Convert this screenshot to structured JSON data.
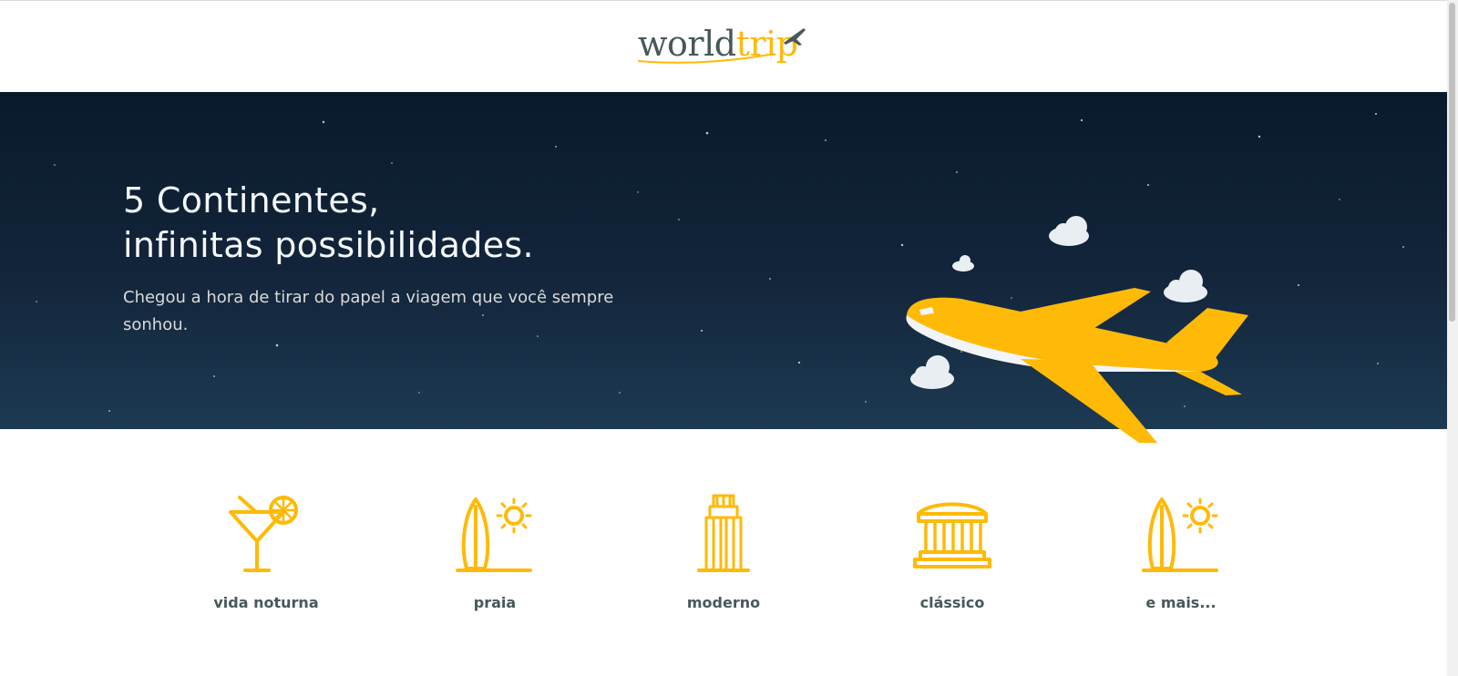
{
  "header": {
    "logo": {
      "part1": "world",
      "part2": "trip",
      "icon": "airplane-icon"
    }
  },
  "hero": {
    "title_line1": "5 Continentes,",
    "title_line2": "infinitas possibilidades.",
    "subtitle": "Chegou a hora de tirar do papel a viagem que você sempre sonhou.",
    "illustration": "airplane-with-clouds"
  },
  "travel_types": [
    {
      "label": "vida noturna",
      "icon": "cocktail-icon"
    },
    {
      "label": "praia",
      "icon": "surfboard-sun-icon"
    },
    {
      "label": "moderno",
      "icon": "skyscraper-icon"
    },
    {
      "label": "clássico",
      "icon": "classical-building-icon"
    },
    {
      "label": "e mais...",
      "icon": "surfboard-sun-icon"
    }
  ],
  "colors": {
    "highlight": "#ffba08",
    "dark_text": "#47585b",
    "hero_background": "#0f2236",
    "light_text": "#f5f8fa"
  }
}
